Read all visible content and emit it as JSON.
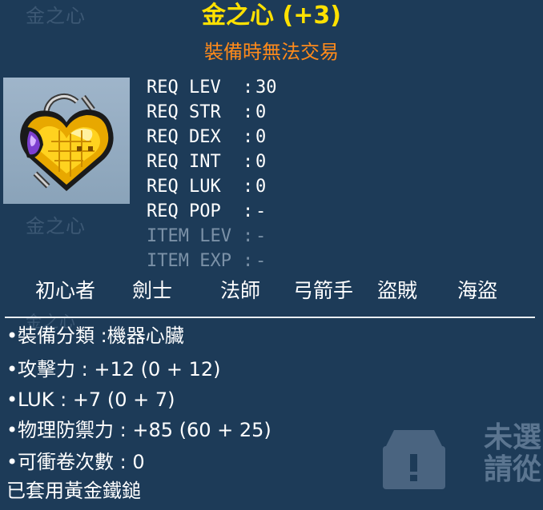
{
  "item": {
    "ghost_name_top": "金之心",
    "ghost_name_mid": "金之心",
    "ghost_name_low": "金之心",
    "title": "金之心 (+3)",
    "subtitle": "裝備時無法交易",
    "requirements": [
      {
        "label": "REQ LEV",
        "sep": ":",
        "value": "30",
        "dim": false
      },
      {
        "label": "REQ STR",
        "sep": ":",
        "value": "0",
        "dim": false
      },
      {
        "label": "REQ DEX",
        "sep": ":",
        "value": "0",
        "dim": false
      },
      {
        "label": "REQ INT",
        "sep": ":",
        "value": "0",
        "dim": false
      },
      {
        "label": "REQ LUK",
        "sep": ":",
        "value": "0",
        "dim": false
      },
      {
        "label": "REQ POP",
        "sep": ":",
        "value": "-",
        "dim": false
      },
      {
        "label": "ITEM LEV",
        "sep": ":",
        "value": "-",
        "dim": true
      },
      {
        "label": "ITEM EXP",
        "sep": ":",
        "value": "-",
        "dim": true
      }
    ],
    "jobs": [
      "初心者",
      "劍士",
      "法師",
      "弓箭手",
      "盜賊",
      "海盜"
    ],
    "stats": [
      "裝備分類 :機器心臟",
      "攻擊力 : +12 (0 + 12)",
      "LUK : +7 (0 + 7)",
      "物理防禦力 : +85 (60 + 25)",
      "可衝卷次數 : 0"
    ],
    "footer": "已套用黃金鐵鎚",
    "background_text": [
      "未選",
      "請從"
    ],
    "colors": {
      "title": "#ffe100",
      "subtitle": "#ff8a1a",
      "dim": "#7b91a7",
      "panel": "#1d3b58"
    },
    "icon": "gold-heart-icon"
  }
}
